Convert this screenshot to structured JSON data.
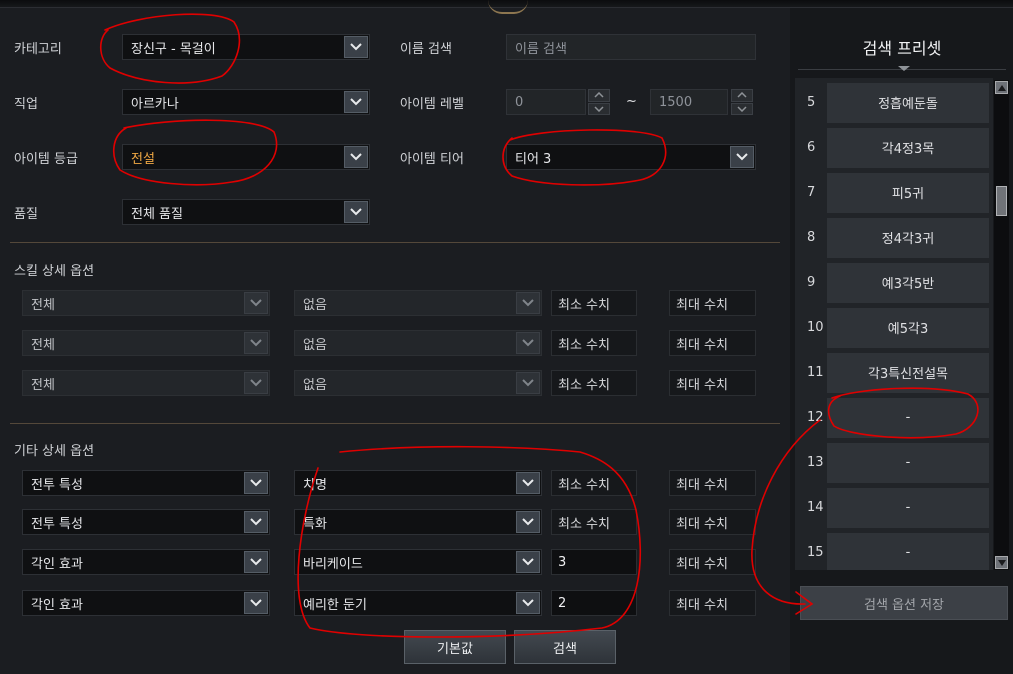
{
  "filters": {
    "category_label": "카테고리",
    "category_value": "장신구 - 목걸이",
    "name_search_label": "이름 검색",
    "name_search_placeholder": "이름 검색",
    "class_label": "직업",
    "class_value": "아르카나",
    "item_level_label": "아이템 레벨",
    "item_level_min": "0",
    "item_level_max": "1500",
    "level_separator": "~",
    "grade_label": "아이템 등급",
    "grade_value": "전설",
    "tier_label": "아이템 티어",
    "tier_value": "티어 3",
    "quality_label": "품질",
    "quality_value": "전체 품질"
  },
  "skill_options": {
    "title": "스킬 상세 옵션",
    "rows": [
      {
        "skill": "전체",
        "tripod": "없음",
        "min": "최소 수치",
        "max": "최대 수치"
      },
      {
        "skill": "전체",
        "tripod": "없음",
        "min": "최소 수치",
        "max": "최대 수치"
      },
      {
        "skill": "전체",
        "tripod": "없음",
        "min": "최소 수치",
        "max": "최대 수치"
      }
    ]
  },
  "etc_options": {
    "title": "기타 상세 옵션",
    "rows": [
      {
        "type": "전투 특성",
        "option": "치명",
        "min": "최소 수치",
        "max": "최대 수치"
      },
      {
        "type": "전투 특성",
        "option": "특화",
        "min": "최소 수치",
        "max": "최대 수치"
      },
      {
        "type": "각인 효과",
        "option": "바리케이드",
        "min": "3",
        "max": "최대 수치"
      },
      {
        "type": "각인 효과",
        "option": "예리한 둔기",
        "min": "2",
        "max": "최대 수치"
      }
    ]
  },
  "buttons": {
    "default": "기본값",
    "search": "검색"
  },
  "presets": {
    "title": "검색 프리셋",
    "items": [
      {
        "num": "5",
        "name": "정흡예둔돌"
      },
      {
        "num": "6",
        "name": "각4정3목"
      },
      {
        "num": "7",
        "name": "피5귀"
      },
      {
        "num": "8",
        "name": "정4각3귀"
      },
      {
        "num": "9",
        "name": "예3각5반"
      },
      {
        "num": "10",
        "name": "예5각3"
      },
      {
        "num": "11",
        "name": "각3특신전설목"
      },
      {
        "num": "12",
        "name": "-"
      },
      {
        "num": "13",
        "name": "-"
      },
      {
        "num": "14",
        "name": "-"
      },
      {
        "num": "15",
        "name": "-"
      }
    ],
    "save_label": "검색 옵션 저장"
  },
  "colors": {
    "accent_orange": "#f0a844",
    "annotation_red": "#e00000"
  }
}
